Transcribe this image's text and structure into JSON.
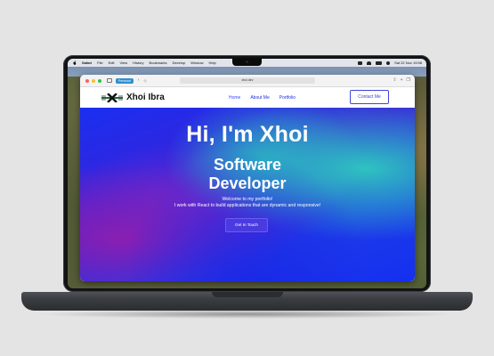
{
  "menubar": {
    "app": "Safari",
    "items": [
      "File",
      "Edit",
      "View",
      "History",
      "Bookmarks",
      "Develop",
      "Window",
      "Help"
    ],
    "clock": "Sat 22 Nov 19:58"
  },
  "browser": {
    "profile": "Personal",
    "url": "xhoi.dev"
  },
  "site": {
    "brand": "Xhoi Ibra",
    "nav": [
      "Home",
      "About Me",
      "Portfolio"
    ],
    "contact_button": "Contact Me",
    "hero": {
      "title": "Hi, I'm Xhoi",
      "subtitle_line1": "Software",
      "subtitle_line2": "Developer",
      "text_line1": "Welcome to my portfolio!",
      "text_line2": "I work with React to build applications that are dynamic and responsive!",
      "cta": "Get In Touch"
    }
  },
  "colors": {
    "accent": "#3f45d8",
    "hero_primary": "#1a2ff0",
    "hero_teal": "#2ec4c0",
    "hero_purple": "#8a1fb2"
  },
  "icons": [
    "apple-logo-icon",
    "wifi-icon",
    "battery-icon",
    "search-icon",
    "share-icon",
    "new-tab-icon",
    "tabs-icon",
    "shield-icon"
  ]
}
